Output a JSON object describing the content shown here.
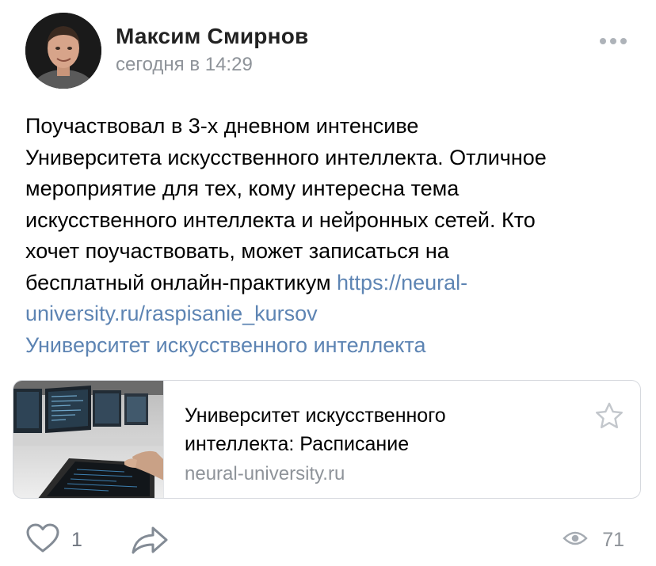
{
  "post": {
    "author": "Максим Смирнов",
    "timestamp": "сегодня в 14:29",
    "text_lines": [
      "Поучаствовал в 3-х дневном интенсиве",
      "Университета искусственного интеллекта. Отличное",
      "мероприятие для тех, кому интересна тема",
      "искусственного интеллекта и нейронных сетей. Кто",
      "хочет поучаствовать, может записаться на",
      "бесплатный онлайн-практикум "
    ],
    "url_part1": "https://neural-",
    "url_part2": "university.ru/raspisanie_kursov",
    "mention_link": "Университет искусственного интеллекта",
    "link_color": "#5d84b3"
  },
  "attachment": {
    "title_line1": "Университет искусственного",
    "title_line2": "интеллекта: Расписание",
    "domain": "neural-university.ru",
    "image_icon": "laptop-code-photo",
    "bookmark_icon": "star-icon"
  },
  "footer": {
    "like_icon": "heart-icon",
    "likes": "1",
    "share_icon": "share-arrow-icon",
    "views_icon": "eye-icon",
    "views": "71"
  },
  "header": {
    "more_icon": "more-dots-icon"
  }
}
